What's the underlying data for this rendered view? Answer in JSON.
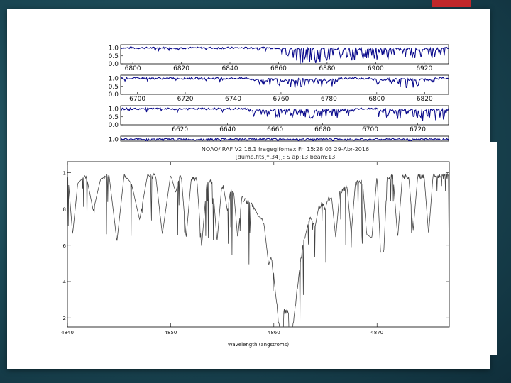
{
  "slide": {
    "colors": {
      "background": "#1c4a57",
      "slide": "#ffffff",
      "accent": "#c0282b",
      "top_series": "#0a0a8c",
      "bottom_series": "#444444"
    }
  },
  "chart_data": [
    {
      "type": "line",
      "title": "",
      "xlabel": "",
      "ylabel": "",
      "panels": [
        {
          "xlim": [
            6795,
            6930
          ],
          "ylim": [
            0,
            1.2
          ],
          "xticks": [
            6800,
            6820,
            6840,
            6860,
            6880,
            6900,
            6920
          ],
          "yticks": [
            "1.0",
            "0.5",
            "0.0"
          ],
          "series": [
            {
              "x": [
                6795,
                6860,
                6866,
                6870,
                6873,
                6876,
                6880,
                6884,
                6888,
                6892,
                6896,
                6900,
                6906,
                6912,
                6918,
                6924,
                6930
              ],
              "y": [
                1.0,
                1.0,
                0.55,
                0.4,
                0.5,
                0.45,
                0.55,
                0.6,
                0.7,
                0.6,
                0.75,
                0.7,
                0.75,
                0.8,
                0.75,
                0.8,
                1.0
              ]
            }
          ]
        },
        {
          "xlim": [
            6693,
            6830
          ],
          "ylim": [
            0,
            1.2
          ],
          "xticks": [
            6700,
            6720,
            6740,
            6760,
            6780,
            6800,
            6820
          ],
          "yticks": [
            "1.0",
            "0.5",
            "0.0"
          ],
          "series": [
            {
              "x": [
                6693,
                6740,
                6766,
                6790,
                6812,
                6830
              ],
              "y": [
                1.0,
                1.0,
                0.8,
                1.0,
                0.85,
                1.0
              ]
            }
          ]
        },
        {
          "xlim": [
            6595,
            6733
          ],
          "ylim": [
            0,
            1.2
          ],
          "xticks": [
            6620,
            6640,
            6660,
            6680,
            6700,
            6720
          ],
          "yticks": [
            "1.0",
            "0.5",
            "0.0"
          ],
          "series": [
            {
              "x": [
                6595,
                6640,
                6675,
                6700,
                6731,
                6733
              ],
              "y": [
                1.0,
                1.0,
                0.8,
                1.0,
                0.5,
                1.0
              ]
            }
          ]
        },
        {
          "partial": true,
          "xlim": [
            6595,
            6733
          ],
          "ylim": [
            0,
            1.2
          ],
          "yticks": [
            "1.0"
          ],
          "series": [
            {
              "x": [
                6595,
                6733
              ],
              "y": [
                1.0,
                1.0
              ]
            }
          ]
        }
      ],
      "header_lines": [
        "NOAO/IRAF V2.16.1 fragegifomax Fri 15:28:03 29-Abr-2016",
        "[dumo.fits[*,34]]: S  ap:13 beam:13"
      ]
    },
    {
      "type": "line",
      "title": "",
      "xlabel": "Wavelength (angstroms)",
      "ylabel": "",
      "xlim": [
        4840,
        4877
      ],
      "ylim": [
        0.15,
        1.06
      ],
      "xticks": [
        4840,
        4850,
        4860,
        4870
      ],
      "yticks": [
        {
          "value": 1.0,
          "label": "1"
        },
        {
          "value": 0.8,
          "label": ".8"
        },
        {
          "value": 0.6,
          "label": ".6"
        },
        {
          "value": 0.4,
          "label": ".4"
        },
        {
          "value": 0.2,
          "label": ".2"
        }
      ],
      "series": [
        {
          "x": [
            4840.0,
            4840.5,
            4841.0,
            4841.8,
            4842.5,
            4843.2,
            4844.0,
            4844.8,
            4845.5,
            4846.2,
            4847.0,
            4847.8,
            4848.5,
            4849.2,
            4850.0,
            4850.5,
            4851.0,
            4851.5,
            4852.0,
            4852.5,
            4853.0,
            4853.5,
            4854.0,
            4854.5,
            4855.0,
            4855.5,
            4856.0,
            4856.5,
            4857.0,
            4857.5,
            4858.0,
            4858.5,
            4859.0,
            4859.5,
            4860.0,
            4860.4,
            4860.8,
            4861.2,
            4861.6,
            4862.0,
            4862.5,
            4863.0,
            4863.5,
            4864.0,
            4864.5,
            4865.0,
            4865.5,
            4866.0,
            4866.5,
            4867.0,
            4867.5,
            4868.0,
            4868.5,
            4869.0,
            4869.5,
            4870.0,
            4870.5,
            4871.0,
            4871.5,
            4872.0,
            4872.5,
            4873.0,
            4873.5,
            4874.0,
            4874.5,
            4875.0,
            4875.5,
            4876.0,
            4876.5,
            4877.0
          ],
          "y": [
            0.98,
            0.62,
            0.9,
            0.95,
            0.75,
            0.92,
            0.96,
            0.58,
            0.95,
            0.9,
            0.7,
            0.96,
            0.97,
            0.62,
            0.95,
            0.85,
            0.97,
            0.6,
            0.93,
            0.96,
            0.55,
            0.9,
            0.95,
            0.58,
            0.92,
            0.75,
            0.93,
            0.6,
            0.88,
            0.82,
            0.78,
            0.72,
            0.7,
            0.45,
            0.55,
            0.32,
            0.26,
            0.22,
            0.38,
            0.35,
            0.55,
            0.6,
            0.72,
            0.66,
            0.82,
            0.76,
            0.88,
            0.6,
            0.93,
            0.95,
            0.62,
            0.97,
            0.98,
            0.62,
            0.6,
            0.95,
            0.32,
            0.96,
            0.98,
            0.6,
            0.97,
            0.99,
            0.64,
            0.98,
            0.99,
            0.62,
            1.0,
            0.98,
            0.99,
            1.0
          ]
        }
      ]
    }
  ]
}
